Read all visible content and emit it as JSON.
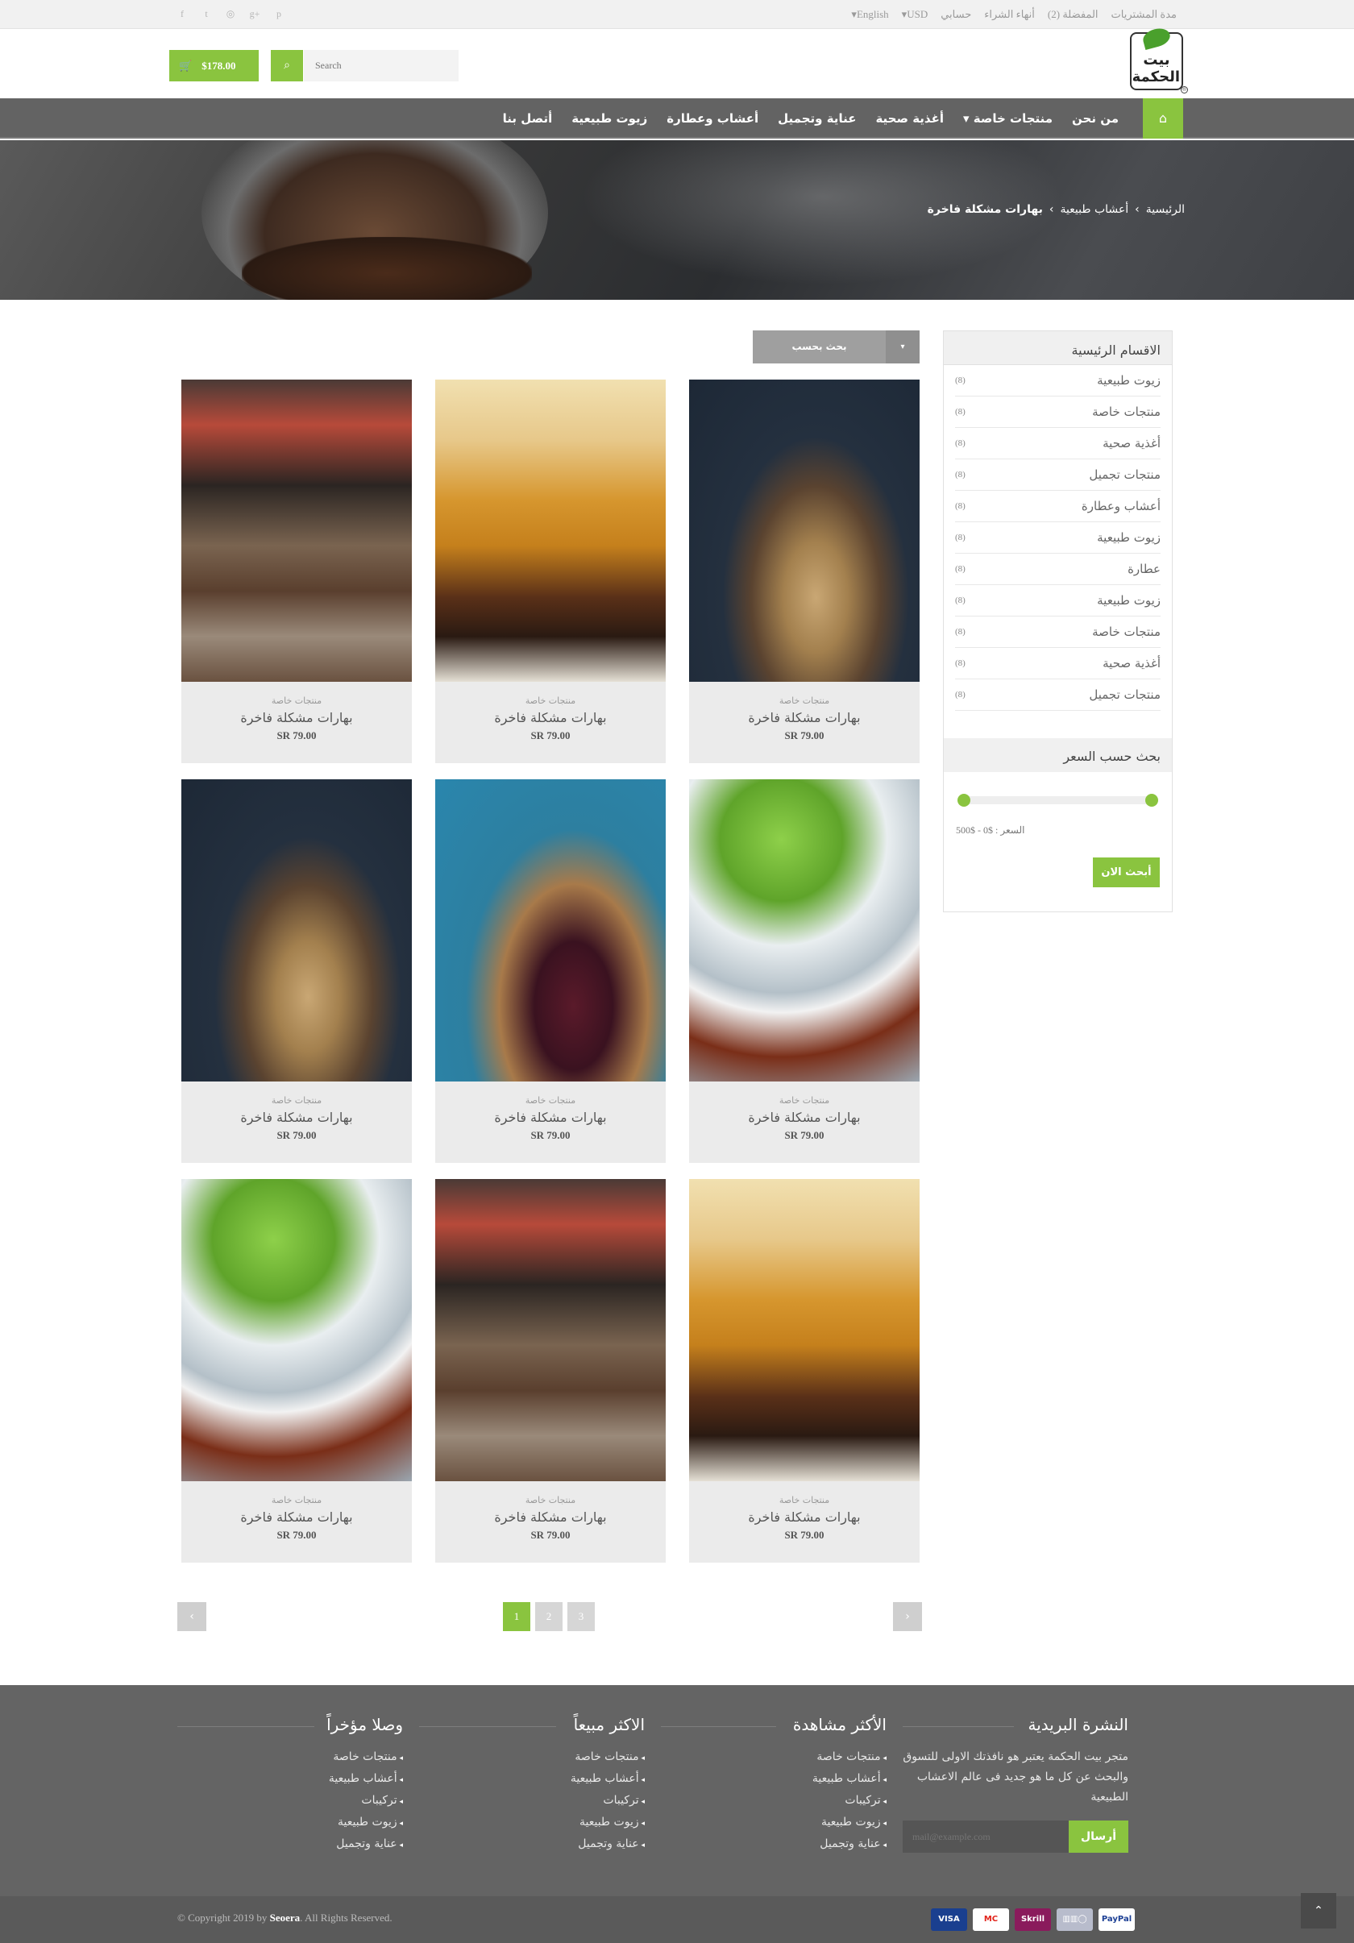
{
  "topbar": {
    "social_icons": [
      "facebook-icon",
      "twitter-icon",
      "dribbble-icon",
      "google-plus-icon",
      "pinterest-icon"
    ],
    "links": [
      "مدة المشتريات",
      "المفضلة (2)",
      "أنهاء الشراء",
      "حسابي",
      "USD▾",
      "English▾"
    ]
  },
  "header": {
    "logo_name": "بيت الحكمة",
    "cart_total": "$178.00",
    "search_placeholder": "Search"
  },
  "nav": {
    "items": [
      "من نحن",
      "منتجات خاصة ▾",
      "أغذية صحية",
      "عناية وتجميل",
      "أعشاب وعطارة",
      "زيوت طبيعية",
      "أتصل بنا"
    ]
  },
  "breadcrumb": {
    "home": "الرئيسية",
    "section": "أعشاب طبيعية",
    "current": "بهارات مشكلة فاخرة",
    "separator": "›"
  },
  "sidebar": {
    "title": "الاقسام الرئيسية",
    "categories": [
      {
        "label": "زيوت طبيعية",
        "count": "(8)"
      },
      {
        "label": "منتجات خاصة",
        "count": "(8)"
      },
      {
        "label": "أغذية صحية",
        "count": "(8)"
      },
      {
        "label": "منتجات تجميل",
        "count": "(8)"
      },
      {
        "label": "أعشاب وعطارة",
        "count": "(8)"
      },
      {
        "label": "زيوت طبيعية",
        "count": "(8)"
      },
      {
        "label": "عطارة",
        "count": "(8)"
      },
      {
        "label": "زيوت طبيعية",
        "count": "(8)"
      },
      {
        "label": "منتجات خاصة",
        "count": "(8)"
      },
      {
        "label": "أغذية صحية",
        "count": "(8)"
      },
      {
        "label": "منتجات تجميل",
        "count": "(8)"
      }
    ],
    "price_title": "بحث حسب السعر",
    "price_range": "السعر : $0 - $500",
    "price_button": "أبحث الان"
  },
  "sort": {
    "label": "بحث بحسب",
    "arrow": "▾"
  },
  "products": [
    {
      "category": "منتجات خاصة",
      "name": "بهارات مشكلة فاخرة",
      "price": "SR 79.00",
      "image": "ginger"
    },
    {
      "category": "منتجات خاصة",
      "name": "بهارات مشكلة فاخرة",
      "price": "SR 79.00",
      "image": "powder"
    },
    {
      "category": "منتجات خاصة",
      "name": "بهارات مشكلة فاخرة",
      "price": "SR 79.00",
      "image": "market"
    },
    {
      "category": "منتجات خاصة",
      "name": "بهارات مشكلة فاخرة",
      "price": "SR 79.00",
      "image": "herbs"
    },
    {
      "category": "منتجات خاصة",
      "name": "بهارات مشكلة فاخرة",
      "price": "SR 79.00",
      "image": "plum"
    },
    {
      "category": "منتجات خاصة",
      "name": "بهارات مشكلة فاخرة",
      "price": "SR 79.00",
      "image": "ginger"
    },
    {
      "category": "منتجات خاصة",
      "name": "بهارات مشكلة فاخرة",
      "price": "SR 79.00",
      "image": "powder"
    },
    {
      "category": "منتجات خاصة",
      "name": "بهارات مشكلة فاخرة",
      "price": "SR 79.00",
      "image": "market"
    },
    {
      "category": "منتجات خاصة",
      "name": "بهارات مشكلة فاخرة",
      "price": "SR 79.00",
      "image": "herbs"
    }
  ],
  "pagination": {
    "pages": [
      "1",
      "2",
      "3"
    ],
    "active": "1",
    "prev": "‹",
    "next": "›"
  },
  "footer": {
    "newsletter_title": "النشرة البريدية",
    "newsletter_text": "متجر بيت الحكمة يعتبر هو نافذتك الاولى للتسوق والبحث عن كل ما هو جديد فى عالم الاعشاب الطبيعية",
    "newsletter_placeholder": "mail@example.com",
    "newsletter_button": "أرسال",
    "columns": [
      {
        "title": "الأكثر مشاهدة",
        "items": [
          "منتجات خاصة",
          "أعشاب طبيعية",
          "تركيبات",
          "زيوت طبيعية",
          "عناية وتجميل"
        ]
      },
      {
        "title": "الاكثر مبيعاً",
        "items": [
          "منتجات خاصة",
          "أعشاب طبيعية",
          "تركيبات",
          "زيوت طبيعية",
          "عناية وتجميل"
        ]
      },
      {
        "title": "وصلا مؤخراً",
        "items": [
          "منتجات خاصة",
          "أعشاب طبيعية",
          "تركيبات",
          "زيوت طبيعية",
          "عناية وتجميل"
        ]
      }
    ],
    "copyright_prefix": "© Copyright 2019 by",
    "copyright_brand": "Seoera",
    "copyright_suffix": ". All Rights Reserved.",
    "payments": [
      "VISA",
      "MC",
      "Skrill",
      "▥▥◯",
      "PayPal"
    ]
  },
  "colors": {
    "accent": "#8ac43f",
    "nav": "#636363",
    "footer": "#646464"
  }
}
